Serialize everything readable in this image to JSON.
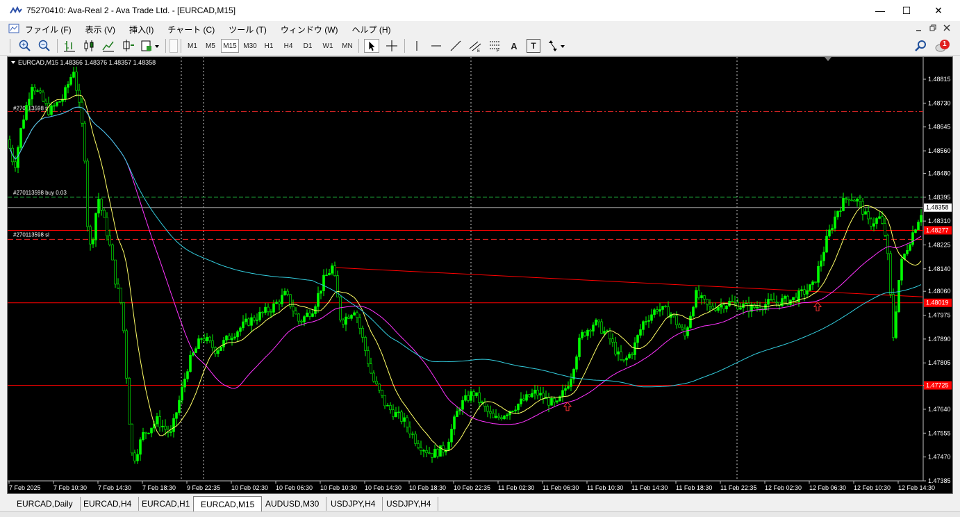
{
  "window": {
    "title": "75270410: Ava-Real 2 - Ava Trade Ltd. - [EURCAD,M15]",
    "minimize": "—",
    "maximize": "☐",
    "close": "✕"
  },
  "menu": {
    "items": [
      "ファイル (F)",
      "表示 (V)",
      "挿入(I)",
      "チャート (C)",
      "ツール (T)",
      "ウィンドウ (W)",
      "ヘルプ (H)"
    ]
  },
  "toolbar": {
    "timeframes": [
      "M1",
      "M5",
      "M15",
      "M30",
      "H1",
      "H4",
      "D1",
      "W1",
      "MN"
    ],
    "active_timeframe": "M15",
    "text_tool": "A",
    "label_tool": "T",
    "alerts_count": "1"
  },
  "chart": {
    "header": "EURCAD,M15  1.48366 1.48376 1.48357 1.48358",
    "price_labels": [
      "1.48815",
      "1.48730",
      "1.48645",
      "1.48560",
      "1.48480",
      "1.48395",
      "1.48310",
      "1.48225",
      "1.48140",
      "1.48060",
      "1.47975",
      "1.47890",
      "1.47805",
      "1.47725",
      "1.47640",
      "1.47555",
      "1.47470",
      "1.47385"
    ],
    "time_labels": [
      "7 Feb 2025",
      "7 Feb 10:30",
      "7 Feb 14:30",
      "7 Feb 18:30",
      "9 Feb 22:35",
      "10 Feb 02:30",
      "10 Feb 06:30",
      "10 Feb 10:30",
      "10 Feb 14:30",
      "10 Feb 18:30",
      "10 Feb 22:35",
      "11 Feb 02:30",
      "11 Feb 06:30",
      "11 Feb 10:30",
      "11 Feb 14:30",
      "11 Feb 18:30",
      "11 Feb 22:35",
      "12 Feb 02:30",
      "12 Feb 06:30",
      "12 Feb 10:30",
      "12 Feb 14:30"
    ],
    "current_price": "1.48358",
    "level_red_1": "1.48277",
    "level_red_2": "1.48019",
    "level_red_3": "1.47725",
    "order_tp_label": "#270113598 tp",
    "order_buy_label": "#270113598 buy 0.03",
    "order_sl_label": "#270113598 sl",
    "colors": {
      "background": "#000000",
      "candle": "#00ff00",
      "ma_fast": "#ffff66",
      "ma_mid": "#ff33ff",
      "ma_slow": "#33ccdd",
      "level": "#ff0000"
    }
  },
  "tabs": [
    "EURCAD,Daily",
    "EURCAD,H4",
    "EURCAD,H1",
    "EURCAD,M15",
    "AUDUSD,M30",
    "USDJPY,H4",
    "USDJPY,H4"
  ],
  "active_tab": "EURCAD,M15"
}
